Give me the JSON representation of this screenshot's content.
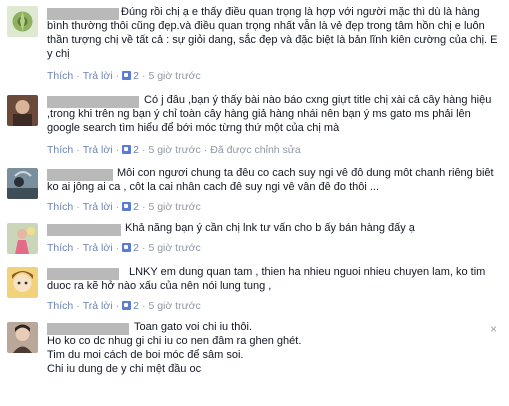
{
  "comments": [
    {
      "text": "Đúng rồi chị ạ e thấy điều quan trọng là hợp với người mặc thì dù là hàng bình thường thôi cũng đẹp.và điều quan trọng nhất vẫn là vẻ đẹp trong tâm hồn chị e luôn thần tượng chị về tất cả : sự giỏi dang, sắc đẹp và đặc biệt là bản lĩnh kiên cường của chị. E y chị",
      "like": "Thích",
      "reply": "Trả lời",
      "likes": "2",
      "time": "5 giờ trước",
      "edited": ""
    },
    {
      "text": "Có j đâu ,bạn ý thấy bài nào báo cxng giựt title chị xài cả cây hàng hiệu ,trong khi trên ng bạn ý chỉ toàn cây hàng giả hàng nhái nên bạn ý ms gato ms phải lên google search tìm hiểu để bới móc từng thứ một của chị mà",
      "like": "Thích",
      "reply": "Trả lời",
      "likes": "2",
      "time": "5 giờ trước",
      "edited": "Đã được chỉnh sửa"
    },
    {
      "text": "Môi con ngươi chung ta đêu co cach suy ngi vê đô dung môt chanh riêng biêt ko ai jông ai ca , côt la cai nhân cach đê suy ngi vê vân đê đo thôi ...",
      "like": "Thích",
      "reply": "Trả lời",
      "likes": "2",
      "time": "5 giờ trước",
      "edited": ""
    },
    {
      "text": "Khả năng bạn ý cần chị lnk tư vấn cho b ấy bán hàng đấy ạ",
      "like": "Thích",
      "reply": "Trả lời",
      "likes": "2",
      "time": "5 giờ trước",
      "edited": ""
    },
    {
      "text": "LNKY em dung quan tam , thien ha nhieu nguoi nhieu chuyen lam, ko tim duoc ra kẽ hở nào xấu của nên nói lung tung ,",
      "like": "Thích",
      "reply": "Trả lời",
      "likes": "2",
      "time": "5 giờ trước",
      "edited": ""
    },
    {
      "text": "Toan gato voi chi iu thôi.\nHo ko co dc nhug gi chi iu co nen đâm ra ghen ghét.\nTim du moi cách de boi móc để sâm soi.\nChi iu dung de y chi mệt đầu oc",
      "like": "",
      "reply": "",
      "likes": "",
      "time": "",
      "edited": "",
      "close": "×"
    }
  ]
}
